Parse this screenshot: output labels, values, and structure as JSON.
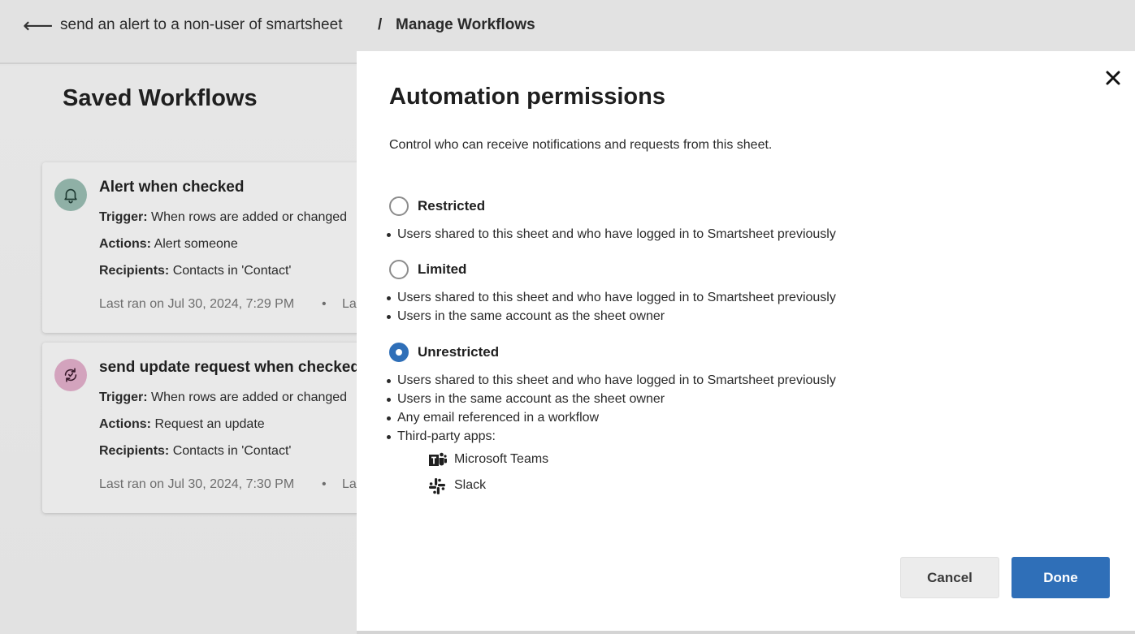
{
  "header": {
    "sheet_name": "send an alert to a non-user of smartsheet",
    "separator": "/",
    "current": "Manage Workflows"
  },
  "page": {
    "title": "Saved Workflows"
  },
  "workflows": [
    {
      "name": "Alert when checked",
      "trigger_label": "Trigger:",
      "trigger": "When rows are added or changed",
      "actions_label": "Actions:",
      "actions": "Alert someone",
      "recipients_label": "Recipients:",
      "recipients": "Contacts in 'Contact'",
      "last_ran": "Last ran on Jul 30, 2024, 7:29 PM",
      "dot": "•",
      "meta2": "La",
      "icon": "bell-icon"
    },
    {
      "name": "send update request when checked",
      "trigger_label": "Trigger:",
      "trigger": "When rows are added or changed",
      "actions_label": "Actions:",
      "actions": "Request an update",
      "recipients_label": "Recipients:",
      "recipients": "Contacts in 'Contact'",
      "last_ran": "Last ran on Jul 30, 2024, 7:30 PM",
      "dot": "•",
      "meta2": "La",
      "icon": "refresh-icon"
    }
  ],
  "modal": {
    "title": "Automation permissions",
    "description": "Control who can receive notifications and requests from this sheet.",
    "options": [
      {
        "label": "Restricted",
        "selected": false,
        "bullets": [
          "Users shared to this sheet and who have logged in to Smartsheet previously"
        ]
      },
      {
        "label": "Limited",
        "selected": false,
        "bullets": [
          "Users shared to this sheet and who have logged in to Smartsheet previously",
          "Users in the same account as the sheet owner"
        ]
      },
      {
        "label": "Unrestricted",
        "selected": true,
        "bullets": [
          "Users shared to this sheet and who have logged in to Smartsheet previously",
          "Users in the same account as the sheet owner",
          "Any email referenced in a workflow",
          "Third-party apps:"
        ]
      }
    ],
    "apps": [
      {
        "name": "Microsoft Teams",
        "icon": "microsoft-teams-icon"
      },
      {
        "name": "Slack",
        "icon": "slack-icon"
      }
    ],
    "cancel_label": "Cancel",
    "done_label": "Done"
  },
  "colors": {
    "accent": "#2f6fb8",
    "bell_badge": "#8fb0a6",
    "refresh_badge": "#d3a3bd"
  }
}
